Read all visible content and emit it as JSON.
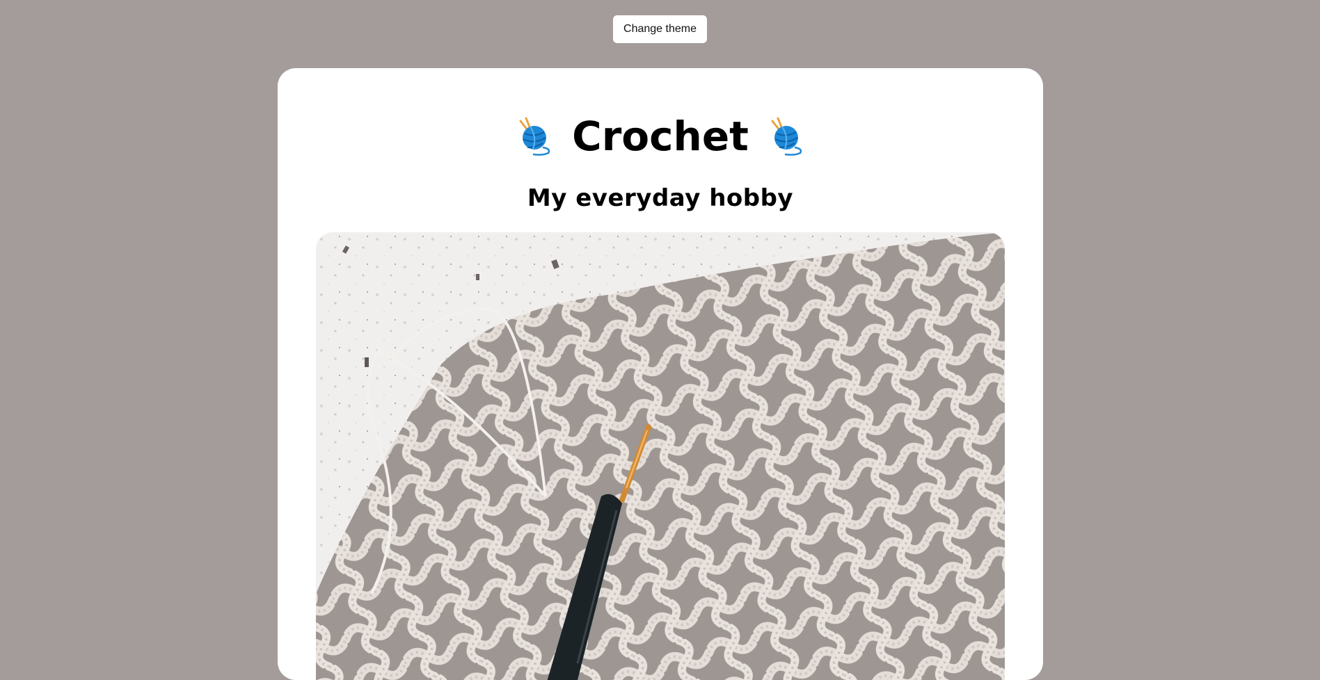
{
  "toolbar": {
    "theme_button_label": "Change theme"
  },
  "header": {
    "title": "Crochet",
    "subtitle": "My everyday hobby",
    "icon_left": "yarn-ball-icon",
    "icon_right": "yarn-ball-icon"
  },
  "photo": {
    "subject": "crochet-net-with-hook-image"
  },
  "colors": {
    "background": "#a39c9a",
    "card": "#ffffff",
    "yarn_blue": "#1e88d8",
    "needle": "#e8a33c"
  }
}
